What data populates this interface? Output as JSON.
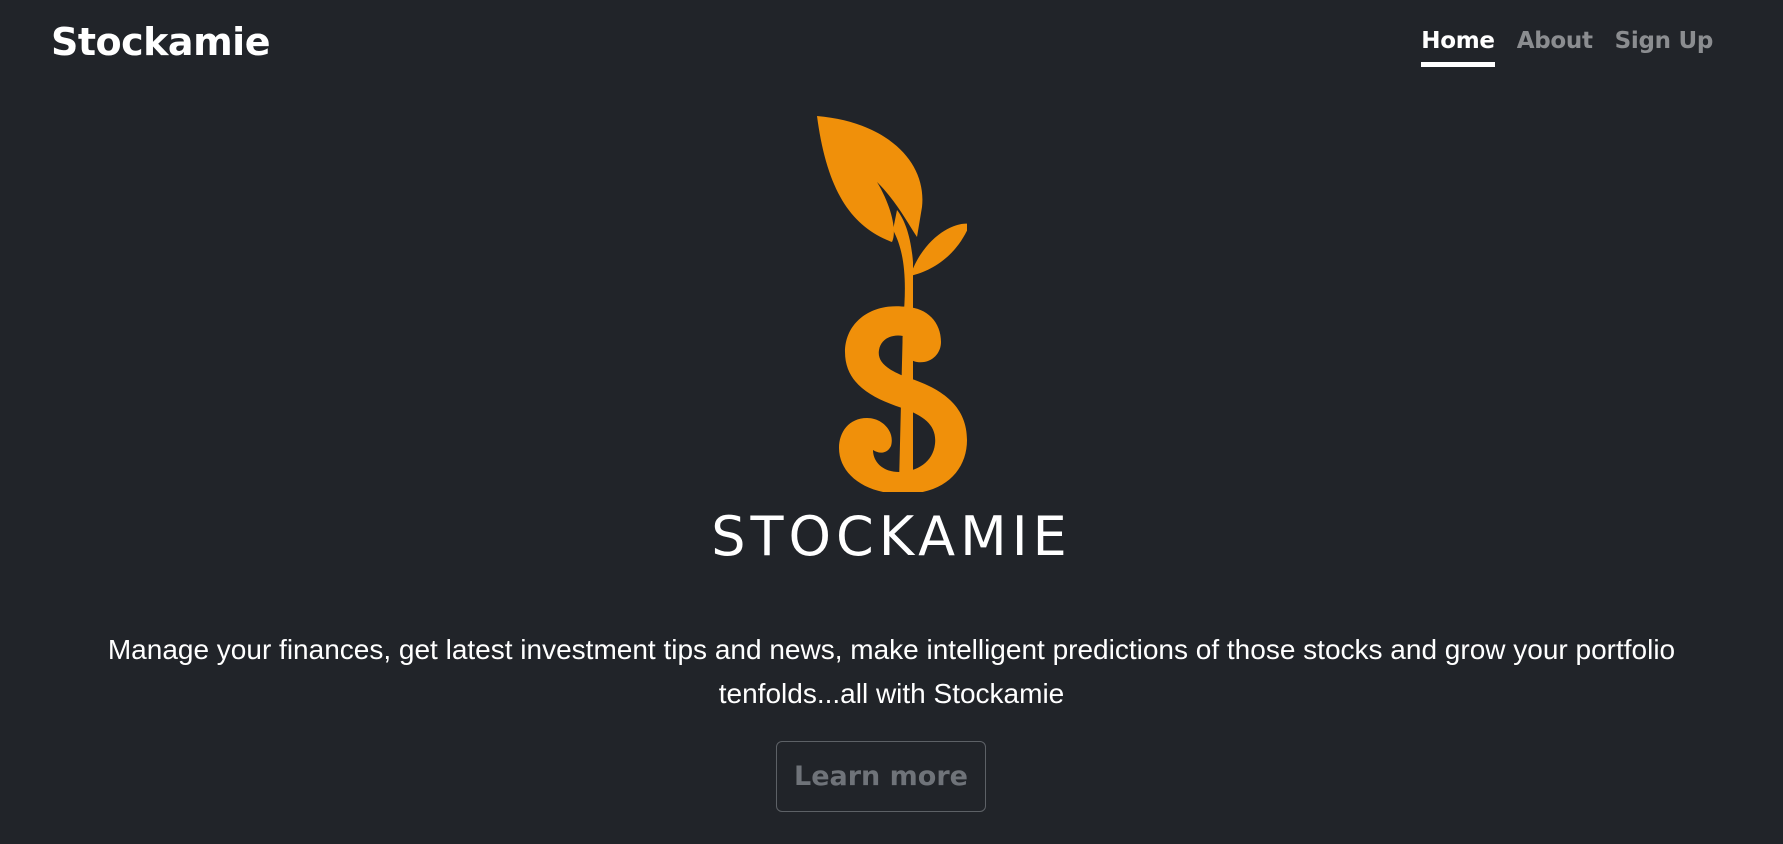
{
  "header": {
    "brand": "Stockamie",
    "nav": [
      {
        "label": "Home",
        "active": true
      },
      {
        "label": "About",
        "active": false
      },
      {
        "label": "Sign Up",
        "active": false
      }
    ]
  },
  "hero": {
    "logo_icon": "dollar-sprout-icon",
    "logo_color": "#f0900a",
    "wordmark": "STOCKAMIE",
    "lead": "Manage your finances, get latest investment tips and news, make intelligent predictions of those stocks and grow your portfolio tenfolds...all with Stockamie",
    "button_label": "Learn more"
  },
  "colors": {
    "background": "#212429",
    "text": "#ffffff",
    "muted": "#8b8d90",
    "accent": "#f0900a"
  }
}
